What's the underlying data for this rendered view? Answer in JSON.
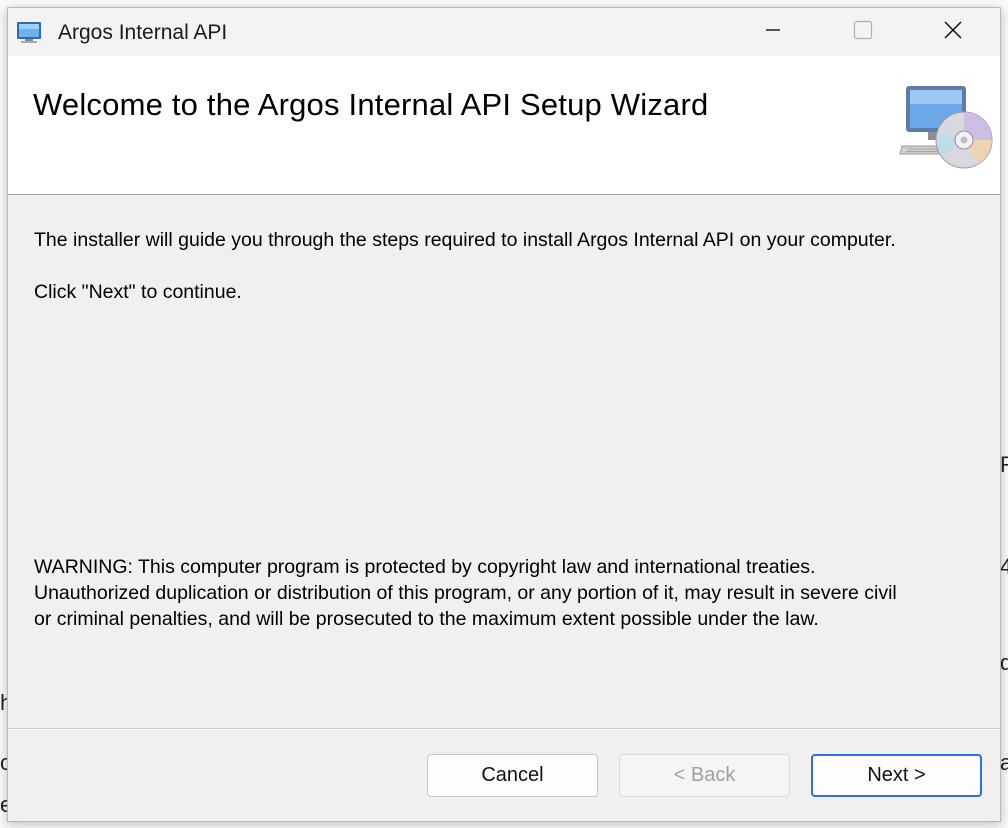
{
  "window": {
    "title": "Argos Internal API",
    "controls": {
      "minimize": "minimize-icon",
      "maximize": "maximize-icon",
      "close": "close-icon"
    }
  },
  "header": {
    "title": "Welcome to the Argos Internal API Setup Wizard",
    "icon": "computer-disc-icon"
  },
  "content": {
    "intro": "The installer will guide you through the steps required to install Argos Internal API on your computer.",
    "click_next": "Click \"Next\" to continue.",
    "warning_lines": [
      "WARNING: This computer program is protected by copyright law and international treaties.",
      "Unauthorized duplication or distribution of this program, or any portion of it, may result in severe civil",
      "or criminal penalties, and will be prosecuted to the maximum extent possible under the law."
    ]
  },
  "buttons": {
    "cancel": "Cancel",
    "back": "< Back",
    "next": "Next >"
  },
  "background_fragments": [
    "R",
    "4",
    "d",
    "h",
    "a",
    "c",
    "e"
  ],
  "colors": {
    "accent": "#2f6fd6",
    "disabled_text": "#a0a0a0",
    "header_bg": "#ffffff",
    "body_bg": "#f0f0f0"
  }
}
